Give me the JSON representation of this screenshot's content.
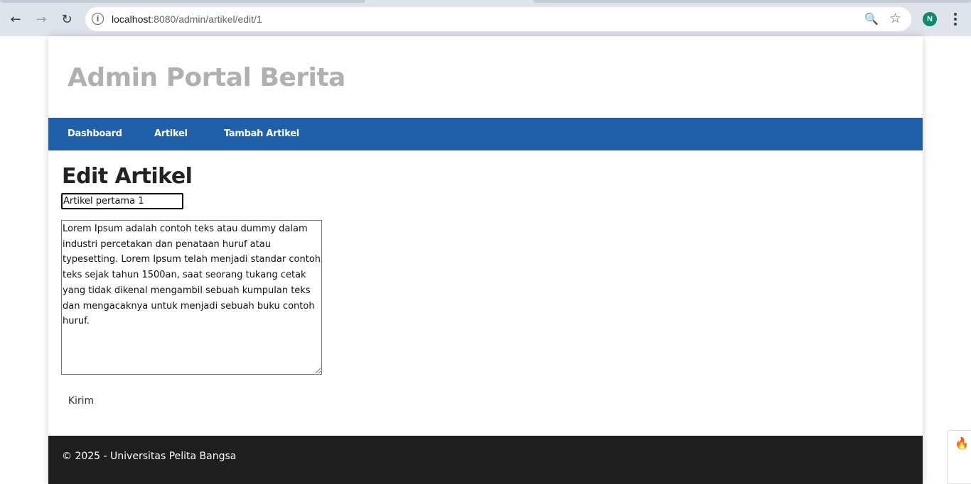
{
  "browser": {
    "url_host": "localhost",
    "url_path": ":8080/admin/artikel/edit/1",
    "back_icon": "←",
    "forward_icon": "→",
    "reload_icon": "↻",
    "info_icon": "i",
    "zoom_icon": "🔍",
    "star_icon": "☆",
    "profile_initial": "N"
  },
  "site": {
    "title": "Admin Portal Berita",
    "nav": [
      {
        "label": "Dashboard"
      },
      {
        "label": "Artikel"
      },
      {
        "label": "Tambah Artikel"
      }
    ]
  },
  "form": {
    "heading": "Edit Artikel",
    "title_value": "Artikel pertama 1",
    "content_value": "Lorem Ipsum adalah contoh teks atau dummy dalam industri percetakan dan penataan huruf atau typesetting. Lorem Ipsum telah menjadi standar contoh teks sejak tahun 1500an, saat seorang tukang cetak yang tidak dikenal mengambil sebuah kumpulan teks dan mengacaknya untuk menjadi sebuah buku contoh huruf.",
    "submit_label": "Kirim"
  },
  "footer": {
    "text": "© 2025 - Universitas Pelita Bangsa"
  },
  "colors": {
    "nav_bg": "#1f5fa9",
    "footer_bg": "#1e1e1e",
    "title_color": "#b0b0b0"
  }
}
